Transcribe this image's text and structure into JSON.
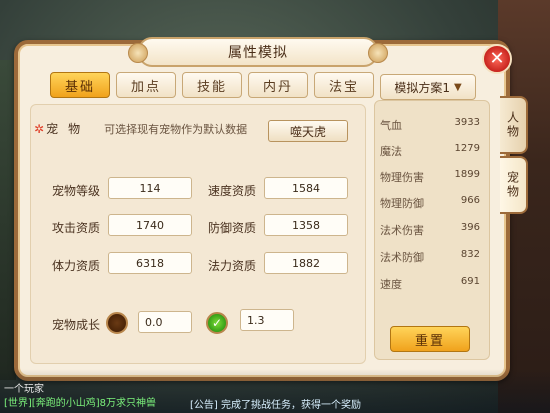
{
  "window": {
    "title": "属性模拟",
    "close_label": "✕"
  },
  "tabs": [
    {
      "label": "基础",
      "active": true
    },
    {
      "label": "加点",
      "active": false
    },
    {
      "label": "技能",
      "active": false
    },
    {
      "label": "内丹",
      "active": false
    },
    {
      "label": "法宝",
      "active": false
    }
  ],
  "pet": {
    "label": "宠物",
    "hint": "可选择现有宠物作为默认数据",
    "selected": "噬天虎"
  },
  "fields": [
    {
      "label": "宠物等级",
      "value": "114"
    },
    {
      "label": "速度资质",
      "value": "1584"
    },
    {
      "label": "攻击资质",
      "value": "1740"
    },
    {
      "label": "防御资质",
      "value": "1358"
    },
    {
      "label": "体力资质",
      "value": "6318"
    },
    {
      "label": "法力资质",
      "value": "1882"
    }
  ],
  "growth": {
    "label": "宠物成长",
    "value_a": "0.0",
    "value_b": "1.3"
  },
  "scheme": {
    "label": "模拟方案1"
  },
  "stats": [
    {
      "label": "气血",
      "value": "3933"
    },
    {
      "label": "魔法",
      "value": "1279"
    },
    {
      "label": "物理伤害",
      "value": "1899"
    },
    {
      "label": "物理防御",
      "value": "966"
    },
    {
      "label": "法术伤害",
      "value": "396"
    },
    {
      "label": "法术防御",
      "value": "832"
    },
    {
      "label": "速度",
      "value": "691"
    }
  ],
  "reset_label": "重置",
  "side_tabs": [
    {
      "label": "人物",
      "active": false
    },
    {
      "label": "宠物",
      "active": true
    }
  ],
  "chat": {
    "line1": "一个玩家",
    "line2": "[世界][奔跑的小山鸡]8万求只神兽",
    "line3": "[公告] 完成了挑战任务，获得一个奖励"
  }
}
